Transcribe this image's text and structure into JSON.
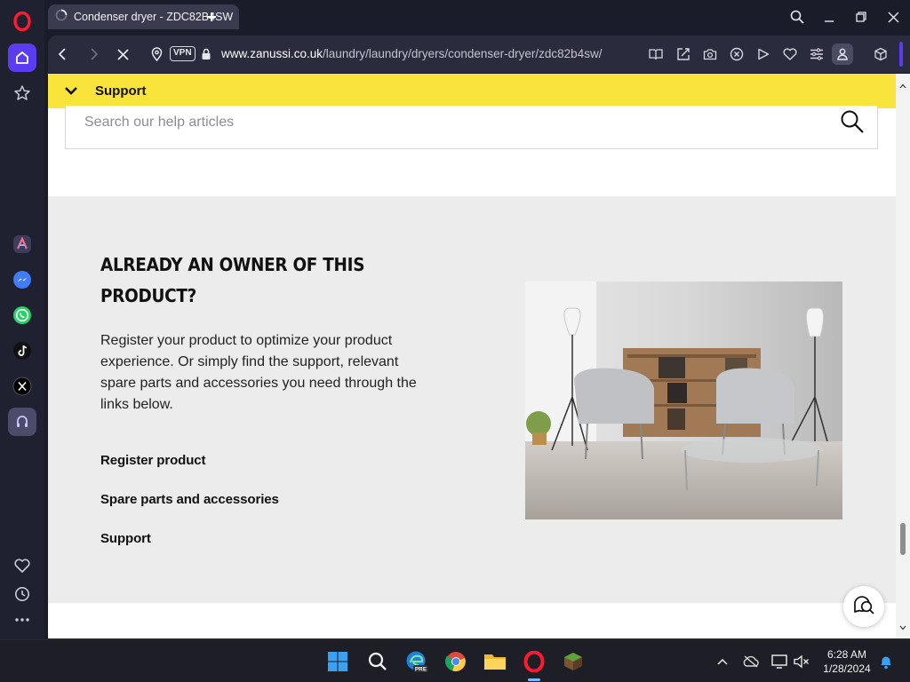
{
  "browser": {
    "tab_title": "Condenser dryer - ZDC82B4SW",
    "address_bar": {
      "vpn_label": "VPN",
      "url_host": "www.zanussi.co.uk",
      "url_path": "/laundry/laundry/dryers/condenser-dryer/zdc82b4sw/"
    }
  },
  "page": {
    "support_bar": {
      "label": "Support"
    },
    "help_search": {
      "placeholder": "Search our help articles",
      "value": ""
    },
    "owner_section": {
      "heading": "ALREADY AN OWNER OF THIS PRODUCT?",
      "description": "Register your product to optimize your product experience. Or simply find the support, relevant spare parts and accessories you need through the links below.",
      "links": [
        "Register product",
        "Spare parts and accessories",
        "Support"
      ]
    }
  },
  "taskbar": {
    "apps": [
      "windows-start",
      "search",
      "edge-beta",
      "chrome",
      "file-explorer",
      "opera",
      "minecraft"
    ],
    "edge_badge": "PRE",
    "clock": {
      "time": "6:28 AM",
      "date": "1/28/2024"
    }
  },
  "colors": {
    "support_bar": "#f8e43a",
    "section_bg": "#ececec",
    "browser_chrome": "#2a2b3c",
    "opera_red": "#ff1b2d"
  }
}
